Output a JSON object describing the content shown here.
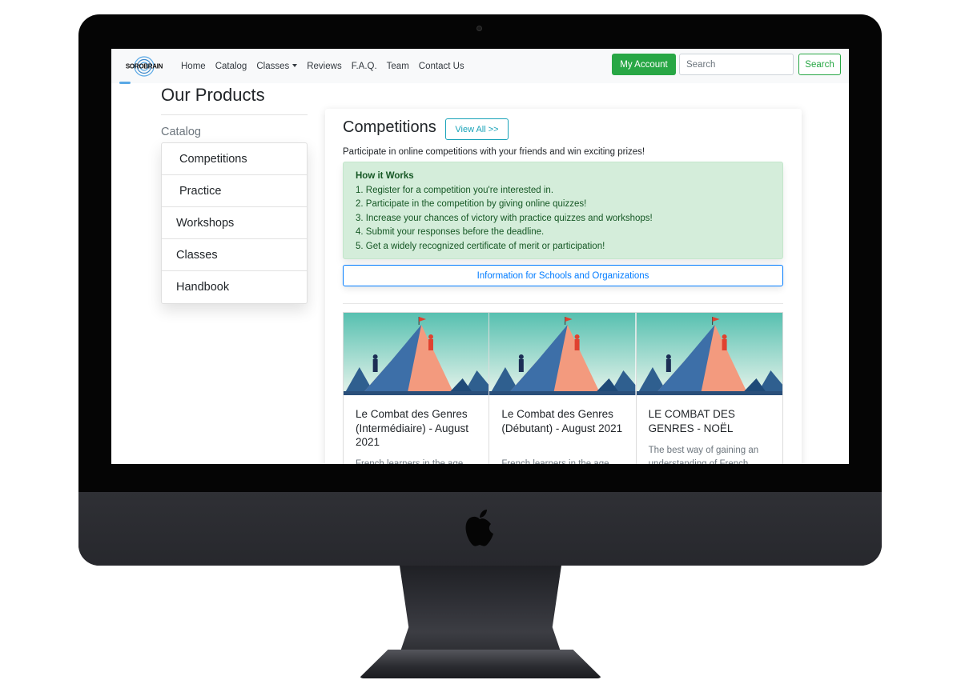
{
  "navbar": {
    "brand": "SOROBRAIN",
    "links": [
      "Home",
      "Catalog",
      "Classes",
      "Reviews",
      "F.A.Q.",
      "Team",
      "Contact Us"
    ],
    "account_label": "My Account",
    "search_placeholder": "Search",
    "search_label": "Search"
  },
  "page": {
    "title": "Our Products",
    "catalog_heading": "Catalog",
    "catalog_items": [
      "Competitions",
      "Practice",
      "Workshops",
      "Classes",
      "Handbook"
    ]
  },
  "competitions": {
    "title": "Competitions",
    "view_all_label": "View All >>",
    "description": "Participate in online competitions with your friends and win exciting prizes!",
    "how_title": "How it Works",
    "how_steps": [
      "1. Register for a competition you're interested in.",
      "2. Participate in the competition by giving online quizzes!",
      "3. Increase your chances of victory with practice quizzes and workshops!",
      "4. Submit your responses before the deadline.",
      "5. Get a widely recognized certificate of merit or participation!"
    ],
    "info_button_label": "Information for Schools and Organizations",
    "products": [
      {
        "title": "Le Combat des Genres (Intermédiaire) - August 2021",
        "desc": "French learners in the age"
      },
      {
        "title": "Le Combat des Genres (Débutant) - August 2021",
        "desc": "French learners in the age"
      },
      {
        "title": "LE COMBAT DES GENRES - NOËL",
        "desc": "The best way of gaining an understanding of French"
      }
    ]
  },
  "colors": {
    "success": "#28a745",
    "info": "#17a2b8",
    "primary": "#007bff",
    "alert_bg": "#d4edda",
    "alert_text": "#155724"
  }
}
